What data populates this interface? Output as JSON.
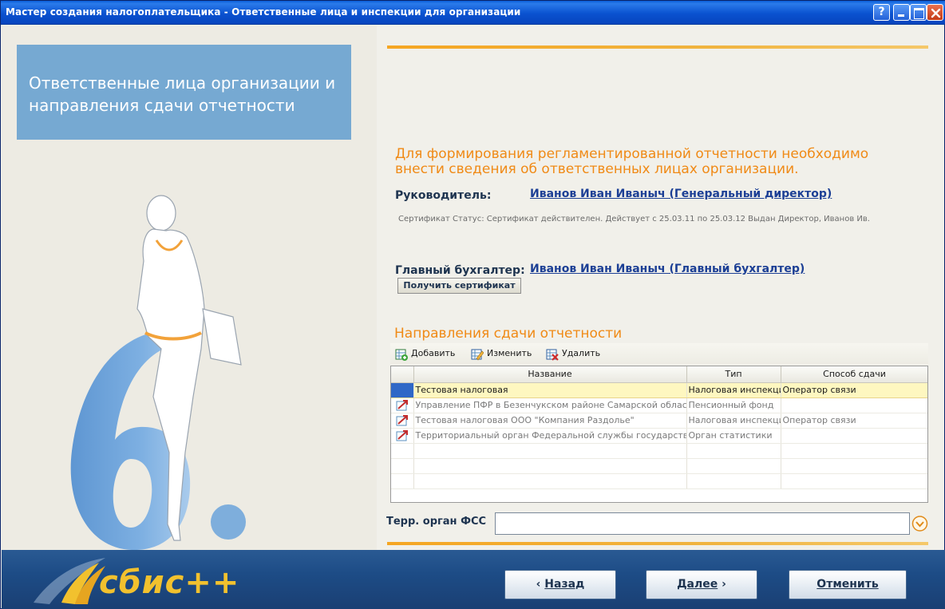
{
  "window": {
    "title": "Мастер создания налогоплательщика - Ответственные лица и инспекции для организации",
    "help_label": "?"
  },
  "hero": {
    "text": "Ответственные лица организации и направления сдачи отчетности"
  },
  "intro": {
    "text": "Для формирования регламентированной отчетности необходимо внести сведения об ответственных лицах организации."
  },
  "director": {
    "label": "Руководитель:",
    "name": "Иванов Иван Иваныч (Генеральный директор)",
    "certificate": "Сертификат Статус: Сертификат действителен. Действует с 25.03.11 по 25.03.12 Выдан Директор, Иванов Ив."
  },
  "accountant": {
    "label": "Главный бухгалтер:",
    "name": "Иванов Иван Иваныч (Главный бухгалтер)",
    "get_cert_button": "Получить сертификат"
  },
  "directions": {
    "title": "Направления сдачи отчетности",
    "toolbar": {
      "add": "Добавить",
      "edit": "Изменить",
      "delete": "Удалить"
    },
    "columns": [
      "Название",
      "Тип",
      "Способ сдачи"
    ],
    "rows": [
      {
        "name": "Тестовая налоговая",
        "type": "Налоговая инспекция",
        "method": "Оператор связи",
        "selected": true
      },
      {
        "name": "Управление ПФР в Безенчукском районе Самарской области",
        "type": "Пенсионный фонд",
        "method": "",
        "selected": false
      },
      {
        "name": "Тестовая налоговая ООО \"Компания Раздолье\"",
        "type": "Налоговая инспекция",
        "method": "Оператор связи",
        "selected": false
      },
      {
        "name": "Территориальный орган Федеральной службы государственной статистики",
        "type": "Орган статистики",
        "method": "",
        "selected": false
      }
    ]
  },
  "fss": {
    "label": "Терр. орган ФСС",
    "value": ""
  },
  "footer": {
    "logo_text": "сбис++",
    "back": "Назад",
    "next": "Далее",
    "cancel": "Отменить"
  },
  "colors": {
    "title_bar": "#0A52D0",
    "accent_orange": "#F08A16",
    "hero_blue": "#76A9D2",
    "footer_blue": "#1D4C86",
    "selected_row": "#FEF7C0"
  }
}
